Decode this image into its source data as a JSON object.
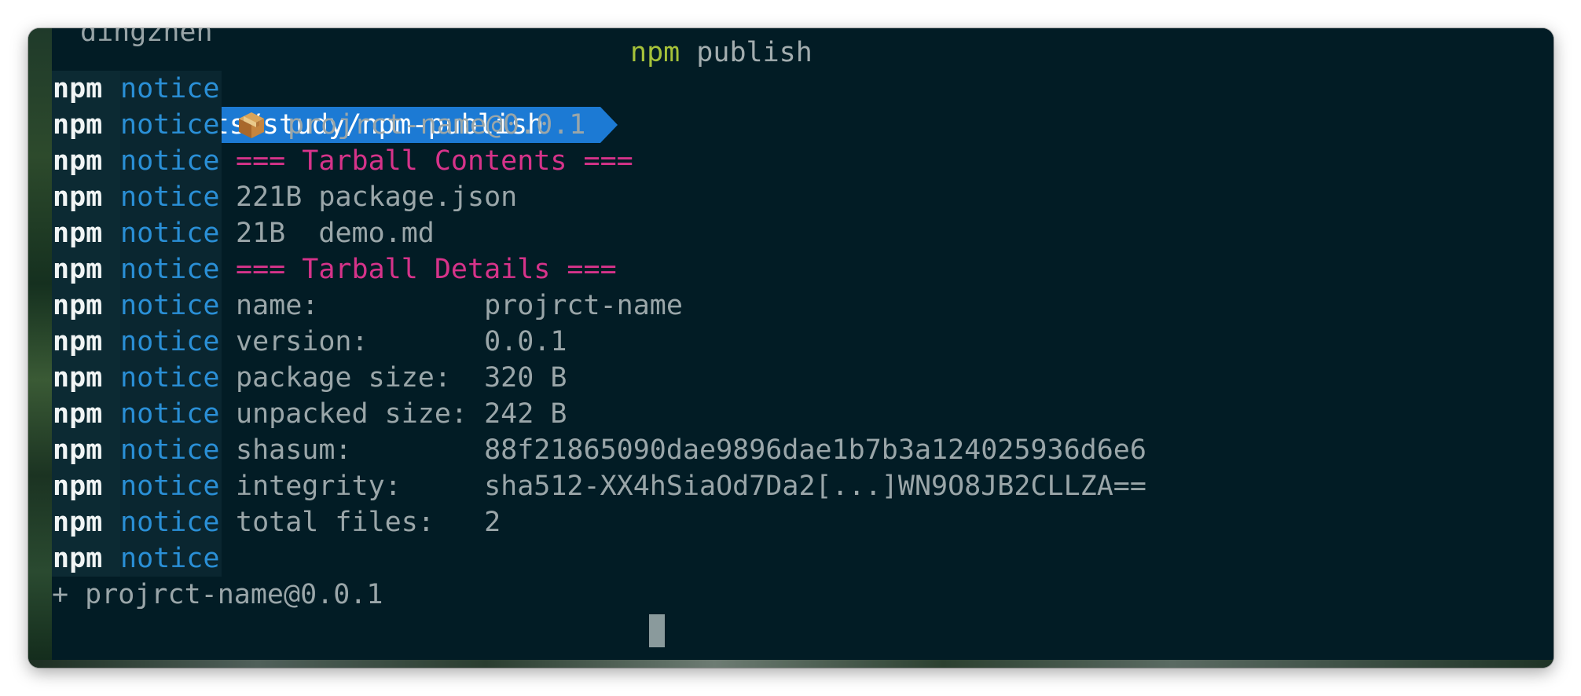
{
  "terminal": {
    "cut_top_text": "dingzhen",
    "prompt_path": "~/Documents/study/npm-publish",
    "command_program": "npm",
    "command_args": "publish",
    "npm_prefix": "npm",
    "notice_label": "notice",
    "package_line": "projrct-name@0.0.1",
    "tarball_contents_header": "=== Tarball Contents ===",
    "files": [
      {
        "size": "221B",
        "name": "package.json"
      },
      {
        "size": "21B ",
        "name": "demo.md"
      }
    ],
    "tarball_details_header": "=== Tarball Details ===",
    "details": [
      {
        "key": "name:          ",
        "value": "projrct-name"
      },
      {
        "key": "version:       ",
        "value": "0.0.1"
      },
      {
        "key": "package size:  ",
        "value": "320 B"
      },
      {
        "key": "unpacked size: ",
        "value": "242 B"
      },
      {
        "key": "shasum:        ",
        "value": "88f21865090dae9896dae1b7b3a124025936d6e6"
      },
      {
        "key": "integrity:     ",
        "value": "sha512-XX4hSiaOd7Da2[...]WN9O8JB2CLLZA=="
      },
      {
        "key": "total files:   ",
        "value": "2"
      }
    ],
    "result_line": "+ projrct-name@0.0.1",
    "icons": {
      "package": "package-box-icon"
    },
    "colors": {
      "background": "#021c25",
      "prompt_segment": "#1c7ad4",
      "notice": "#2a8fd6",
      "header": "#d6338a",
      "command": "#a6c23a"
    }
  }
}
